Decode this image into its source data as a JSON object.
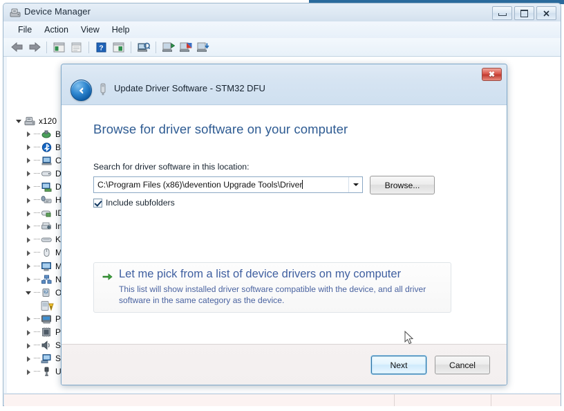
{
  "window": {
    "title": "Device Manager",
    "icon": "device-manager-icon",
    "controls": {
      "minimize": "Minimize",
      "maximize": "Maximize",
      "close": "Close"
    },
    "menu": [
      "File",
      "Action",
      "View",
      "Help"
    ],
    "toolbar": [
      {
        "name": "back-icon",
        "tooltip": "Back"
      },
      {
        "name": "forward-icon",
        "tooltip": "Forward"
      },
      {
        "name": "separator",
        "tooltip": ""
      },
      {
        "name": "show-hide-console-tree-icon",
        "tooltip": "Show/Hide Console Tree"
      },
      {
        "name": "properties-icon",
        "tooltip": "Properties"
      },
      {
        "name": "separator",
        "tooltip": ""
      },
      {
        "name": "help-icon",
        "tooltip": "Help"
      },
      {
        "name": "update-driver-icon",
        "tooltip": "Update Driver Software"
      },
      {
        "name": "separator",
        "tooltip": ""
      },
      {
        "name": "scan-for-hardware-changes-icon",
        "tooltip": "Scan for hardware changes"
      },
      {
        "name": "separator",
        "tooltip": ""
      },
      {
        "name": "enable-device-icon",
        "tooltip": "Enable device"
      },
      {
        "name": "disable-device-icon",
        "tooltip": "Disable device"
      },
      {
        "name": "uninstall-device-icon",
        "tooltip": "Uninstall device"
      }
    ],
    "status_bar": [
      "",
      "",
      ""
    ]
  },
  "tree": {
    "root": {
      "label": "x120",
      "icon": "computer-icon",
      "expanded": true
    },
    "items": [
      {
        "label": "Ba",
        "icon": "batteries-icon",
        "level": 1,
        "expanded": false
      },
      {
        "label": "Bl",
        "icon": "bluetooth-icon",
        "level": 1,
        "expanded": false
      },
      {
        "label": "Co",
        "icon": "computer-icon",
        "level": 1,
        "expanded": false
      },
      {
        "label": "Di",
        "icon": "disk-drives-icon",
        "level": 1,
        "expanded": false
      },
      {
        "label": "Di",
        "icon": "display-adapters-icon",
        "level": 1,
        "expanded": false
      },
      {
        "label": "Hu",
        "icon": "human-interface-devices-icon",
        "level": 1,
        "expanded": false
      },
      {
        "label": "ID",
        "icon": "ide-controllers-icon",
        "level": 1,
        "expanded": false
      },
      {
        "label": "Im",
        "icon": "imaging-devices-icon",
        "level": 1,
        "expanded": false
      },
      {
        "label": "Ke",
        "icon": "keyboards-icon",
        "level": 1,
        "expanded": false
      },
      {
        "label": "Mi",
        "icon": "mice-icon",
        "level": 1,
        "expanded": false
      },
      {
        "label": "Mo",
        "icon": "monitors-icon",
        "level": 1,
        "expanded": false
      },
      {
        "label": "Ne",
        "icon": "network-adapters-icon",
        "level": 1,
        "expanded": false
      },
      {
        "label": "Ot",
        "icon": "other-devices-icon",
        "level": 1,
        "expanded": true
      },
      {
        "label": "",
        "icon": "unknown-device-warning-icon",
        "level": 2,
        "expanded": false
      },
      {
        "label": "Po",
        "icon": "ports-icon",
        "level": 1,
        "expanded": false
      },
      {
        "label": "Pr",
        "icon": "processors-icon",
        "level": 1,
        "expanded": false
      },
      {
        "label": "So",
        "icon": "sound-video-game-controllers-icon",
        "level": 1,
        "expanded": false
      },
      {
        "label": "Sy",
        "icon": "system-devices-icon",
        "level": 1,
        "expanded": false
      },
      {
        "label": "Un",
        "icon": "usb-controllers-icon",
        "level": 1,
        "expanded": false
      }
    ]
  },
  "dialog": {
    "title": "Update Driver Software - STM32 DFU",
    "device_icon": "usb-device-icon",
    "back_button": "back-arrow-icon",
    "close_button": "✖",
    "heading": "Browse for driver software on your computer",
    "location_label": "Search for driver software in this location:",
    "location_value": "C:\\Program Files (x86)\\devention Upgrade Tools\\Driver",
    "browse_button": "Browse...",
    "include_subfolders_label": "Include subfolders",
    "include_subfolders_checked": true,
    "pick_option": {
      "title": "Let me pick from a list of device drivers on my computer",
      "description": "This list will show installed driver software compatible with the device, and all driver software in the same category as the device."
    },
    "next_button": "Next",
    "cancel_button": "Cancel"
  },
  "colors": {
    "dialog_heading": "#2e5b92",
    "link_title": "#3f5fa0",
    "link_desc": "#4a63a0",
    "close_red": "#c03b30",
    "accent_blue": "#2f87d0",
    "status_bar_bg": "#fcf3f2"
  }
}
